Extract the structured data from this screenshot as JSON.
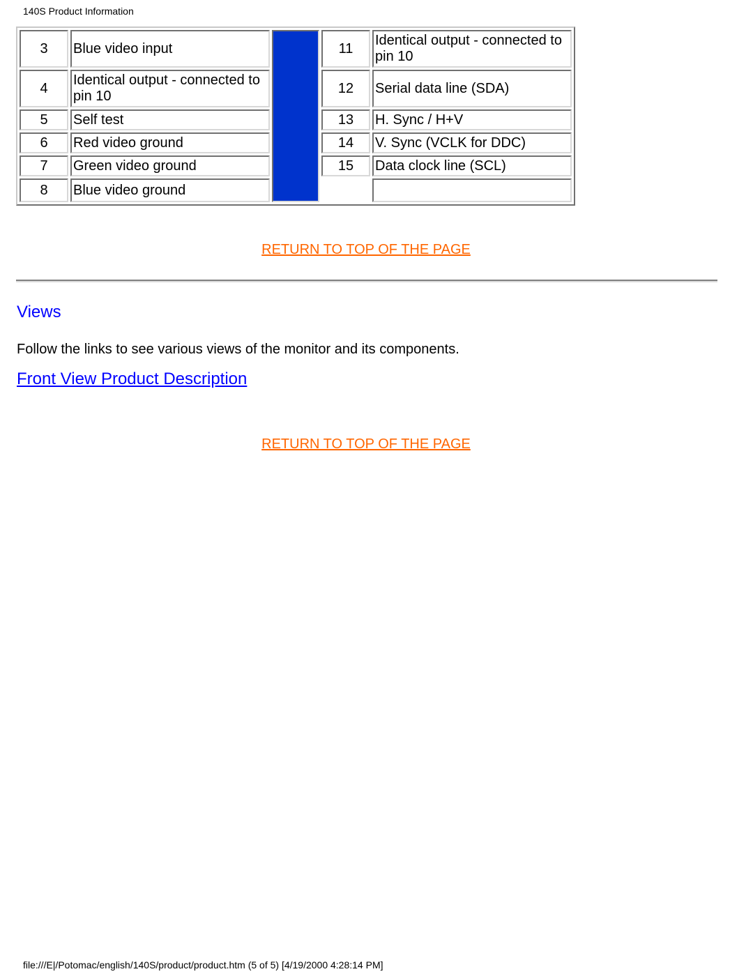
{
  "header": {
    "title": "140S Product Information"
  },
  "pin_table": {
    "left_rows": [
      {
        "pin": "3",
        "description": "Blue video input"
      },
      {
        "pin": "4",
        "description": "Identical output - connected to pin 10"
      },
      {
        "pin": "5",
        "description": "Self test"
      },
      {
        "pin": "6",
        "description": "Red video ground"
      },
      {
        "pin": "7",
        "description": "Green video ground"
      },
      {
        "pin": "8",
        "description": "Blue video ground"
      }
    ],
    "right_rows": [
      {
        "pin": "11",
        "description": "Identical output - connected to pin 10"
      },
      {
        "pin": "12",
        "description": "Serial data line (SDA)"
      },
      {
        "pin": "13",
        "description": "H. Sync / H+V"
      },
      {
        "pin": "14",
        "description": "V. Sync (VCLK for DDC)"
      },
      {
        "pin": "15",
        "description": "Data clock line (SCL)"
      },
      {
        "pin": "",
        "description": ""
      }
    ],
    "divider_color": "#0033cc"
  },
  "links": {
    "return_top_1": "RETURN TO TOP OF THE PAGE",
    "return_top_2": "RETURN TO TOP OF THE PAGE",
    "front_view": "Front View Product Description",
    "link_color": "#0000ff",
    "return_color": "#ff6600"
  },
  "views": {
    "heading": "Views",
    "intro": "Follow the links to see various views of the monitor and its components."
  },
  "footer": {
    "text": "file:///E|/Potomac/english/140S/product/product.htm (5 of 5) [4/19/2000 4:28:14 PM]"
  }
}
